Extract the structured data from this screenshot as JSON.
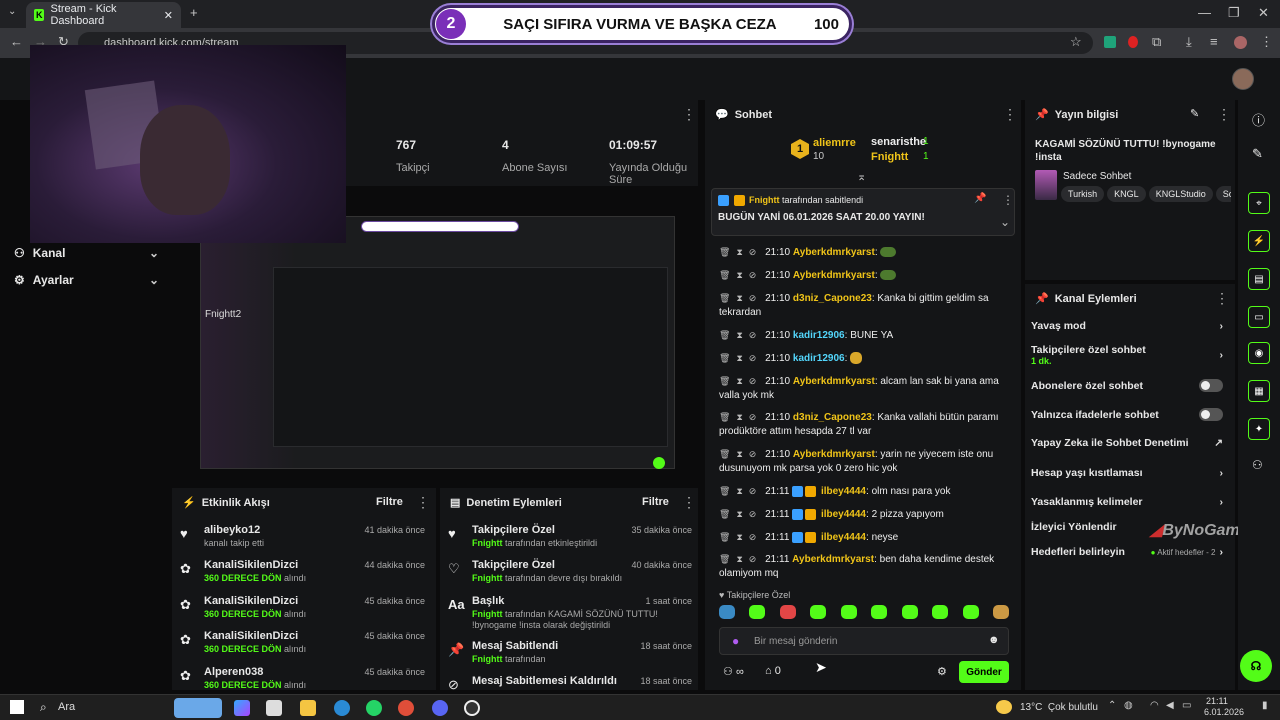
{
  "browser": {
    "tab_title": "Stream - Kick Dashboard",
    "url": "dashboard.kick.com/stream"
  },
  "banner": {
    "number": "2",
    "title": "SAÇI SIFIRA VURMA VE BAŞKA CEZA",
    "score": "100"
  },
  "left_nav": {
    "items": [
      {
        "label": "Kanal"
      },
      {
        "label": "Ayarlar"
      }
    ]
  },
  "stats": [
    {
      "value": "767",
      "label": "Takipçi"
    },
    {
      "value": "4",
      "label": "Abone Sayısı"
    },
    {
      "value": "01:09:57",
      "label": "Yayında Olduğu Süre"
    }
  ],
  "preview_overlay": "Fnightt2",
  "activity": {
    "title": "Etkinlik Akışı",
    "filter": "Filtre",
    "items": [
      {
        "name": "alibeyko12",
        "sub_plain": "kanalı takip etti",
        "sub_hl": "",
        "time": "41 dakika önce"
      },
      {
        "name": "KanaliSikilenDizci",
        "sub_hl": "360 DERECE DÖN",
        "sub_plain": "alındı",
        "time": "44 dakika önce"
      },
      {
        "name": "KanaliSikilenDizci",
        "sub_hl": "360 DERECE DÖN",
        "sub_plain": "alındı",
        "time": "45 dakika önce"
      },
      {
        "name": "KanaliSikilenDizci",
        "sub_hl": "360 DERECE DÖN",
        "sub_plain": "alındı",
        "time": "45 dakika önce"
      },
      {
        "name": "Alperen038",
        "sub_hl": "360 DERECE DÖN",
        "sub_plain": "alındı",
        "time": "45 dakika önce"
      }
    ]
  },
  "moderation": {
    "title": "Denetim Eylemleri",
    "filter": "Filtre",
    "items": [
      {
        "name": "Takipçilere Özel",
        "sub_hl": "Fnightt",
        "sub_plain": "tarafından etkinleştirildi",
        "time": "35 dakika önce"
      },
      {
        "name": "Takipçilere Özel",
        "sub_hl": "Fnightt",
        "sub_plain": "tarafından devre dışı bırakıldı",
        "time": "40 dakika önce"
      },
      {
        "name": "Başlık",
        "sub_hl": "Fnightt",
        "sub_plain": "tarafından KAGAMİ SÖZÜNÜ TUTTU! !bynogame !insta olarak değiştirildi",
        "time": "1 saat önce"
      },
      {
        "name": "Mesaj Sabitlendi",
        "sub_hl": "Fnightt",
        "sub_plain": "tarafından",
        "time": "18 saat önce"
      },
      {
        "name": "Mesaj Sabitlemesi Kaldırıldı",
        "sub_hl": "",
        "sub_plain": "",
        "time": "18 saat önce"
      }
    ]
  },
  "chat": {
    "title": "Sohbet",
    "top_gifters": [
      {
        "rank": "1",
        "name": "aliemrre",
        "count": "10"
      },
      {
        "name": "senaristhe",
        "count": "1"
      },
      {
        "name": "Fnightt",
        "count": "1"
      }
    ],
    "pinned": {
      "by": "Fnightt",
      "by_suffix": "tarafından sabitlendi",
      "text": "BUGÜN YANİ 06.01.2026 SAAT 20.00 YAYIN!"
    },
    "messages": [
      {
        "time": "21:10",
        "user": "Ayberkdmrkyarst",
        "color": "#f0c419",
        "text": ""
      },
      {
        "time": "21:10",
        "user": "Ayberkdmrkyarst",
        "color": "#f0c419",
        "text": ""
      },
      {
        "time": "21:10",
        "user": "d3niz_Capone23",
        "color": "#f0c419",
        "text": "Kanka bi gittim geldim sa tekrardan"
      },
      {
        "time": "21:10",
        "user": "kadir12906",
        "color": "#53d6fc",
        "text": "BUNE YA"
      },
      {
        "time": "21:10",
        "user": "kadir12906",
        "color": "#53d6fc",
        "text": ""
      },
      {
        "time": "21:10",
        "user": "Ayberkdmrkyarst",
        "color": "#f0c419",
        "text": "alcam lan sak bi yana ama valla yok mk"
      },
      {
        "time": "21:10",
        "user": "d3niz_Capone23",
        "color": "#f0c419",
        "text": "Kanka vallahi bütün paramı prodüktöre attım hesapda 27 tl var"
      },
      {
        "time": "21:10",
        "user": "Ayberkdmrkyarst",
        "color": "#f0c419",
        "text": "yarin ne yiyecem iste onu dusunuyom mk parsa yok 0 zero hic yok"
      },
      {
        "time": "21:11",
        "user": "ilbey4444",
        "color": "#f0c419",
        "text": "olm nası para yok"
      },
      {
        "time": "21:11",
        "user": "ilbey4444",
        "color": "#f0c419",
        "text": "2 pizza yapıyom"
      },
      {
        "time": "21:11",
        "user": "ilbey4444",
        "color": "#f0c419",
        "text": "neyse"
      },
      {
        "time": "21:11",
        "user": "Ayberkdmrkyarst",
        "color": "#f0c419",
        "text": "ben daha kendime destek olamiyom mq"
      }
    ],
    "followers_only": "Takipçilere Özel",
    "input_placeholder": "Bir mesaj gönderin",
    "points": "0",
    "send": "Gönder"
  },
  "stream_info": {
    "title": "Yayın bilgisi",
    "stream_title": "KAGAMİ SÖZÜNÜ TUTTU! !bynogame !insta",
    "category": "Sadece Sohbet",
    "tags": [
      "Turkish",
      "KNGL",
      "KNGLStudio",
      "So"
    ]
  },
  "channel_actions": {
    "title": "Kanal Eylemleri",
    "rows": [
      {
        "label": "Yavaş mod",
        "end": "chevron"
      },
      {
        "label": "Takipçilere özel sohbet",
        "sub": "1 dk.",
        "end": "chevron"
      },
      {
        "label": "Abonelere özel sohbet",
        "end": "toggle"
      },
      {
        "label": "Yalnızca ifadelerle sohbet",
        "end": "toggle"
      },
      {
        "label": "Yapay Zeka ile Sohbet Denetimi",
        "end": "external"
      },
      {
        "label": "Hesap yaşı kısıtlaması",
        "end": "chevron"
      },
      {
        "label": "Yasaklanmış kelimeler",
        "end": "chevron"
      },
      {
        "label": "İzleyici Yönlendir",
        "end": ""
      },
      {
        "label": "Hedefleri belirleyin",
        "end": "chevron",
        "extra": "Aktif hedefler - 2"
      }
    ],
    "watermark": "ByNoGame"
  },
  "taskbar": {
    "search": "Ara",
    "weather": "13°C  Çok bulutlu",
    "time": "21:11",
    "date": "6.01.2026"
  },
  "colors": {
    "accent": "#53fc18",
    "panel": "#141517",
    "bg": "#0b0b0c",
    "gold": "#f0c419"
  }
}
